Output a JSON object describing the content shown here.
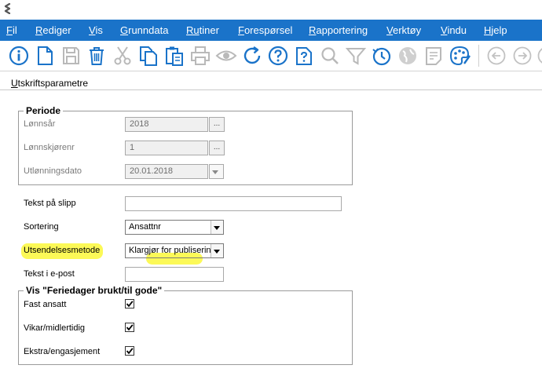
{
  "menu": {
    "items": [
      {
        "first": "F",
        "rest": "il",
        "mid": "",
        "label": "Fil"
      },
      {
        "first": "R",
        "rest": "ediger",
        "label": "Rediger"
      },
      {
        "first": "V",
        "rest": "is",
        "label": "Vis"
      },
      {
        "first": "G",
        "rest": "runndata",
        "label": "Grunndata"
      },
      {
        "first": "Ru",
        "rest": "tiner",
        "label": "Rutiner"
      },
      {
        "first": "F",
        "rest": "orespørsel",
        "label": "Forespørsel"
      },
      {
        "first": "R",
        "rest": "apportering",
        "label": "Rapportering"
      },
      {
        "first": "V",
        "rest": "erktøy",
        "label": "Verktøy"
      },
      {
        "first": "V",
        "rest": "indu",
        "label": "Vindu"
      },
      {
        "first": "H",
        "rest": "jelp",
        "label": "Hjelp"
      }
    ]
  },
  "page": {
    "title_first": "U",
    "title_rest": "tskriftsparametre"
  },
  "periode": {
    "legend": "Periode",
    "lonnsar_label": "Lønnsår",
    "lonnsar_value": "2018",
    "lonnskjorenr_label": "Lønnskjørenr",
    "lonnskjorenr_value": "1",
    "utlonningsdato_label": "Utlønningsdato",
    "utlonningsdato_value": "20.01.2018",
    "dots": "..."
  },
  "form": {
    "tekst_pa_slipp_label": "Tekst på slipp",
    "tekst_pa_slipp_value": "",
    "sortering_label": "Sortering",
    "sortering_value": "Ansattnr",
    "utsendelsesmetode_label": "Utsendelsesmetode",
    "utsendelsesmetode_value": "Klargjør for publisering",
    "tekst_epost_label": "Tekst i e-post",
    "tekst_epost_value": ""
  },
  "feriedager": {
    "legend": "Vis \"Feriedager brukt/til gode\"",
    "fast_ansatt_label": "Fast ansatt",
    "vikar_label": "Vikar/midlertidig",
    "ekstra_label": "Ekstra/engasjement",
    "fast_ansatt_checked": true,
    "vikar_checked": true,
    "ekstra_checked": true
  },
  "colors": {
    "menubar": "#1a73c9",
    "toolbar_icon": "#1a73c9",
    "highlight": "#fcf83a"
  },
  "toolbar": {
    "icons": [
      "info-icon",
      "new-document-icon",
      "save-icon",
      "delete-icon",
      "cut-icon",
      "copy-icon",
      "paste-icon",
      "print-icon",
      "preview-icon",
      "refresh-icon",
      "help-icon",
      "document-query-icon",
      "search-icon",
      "filter-icon",
      "history-icon",
      "globe-icon",
      "notes-icon",
      "palette-icon",
      "back-icon",
      "forward-icon"
    ]
  }
}
